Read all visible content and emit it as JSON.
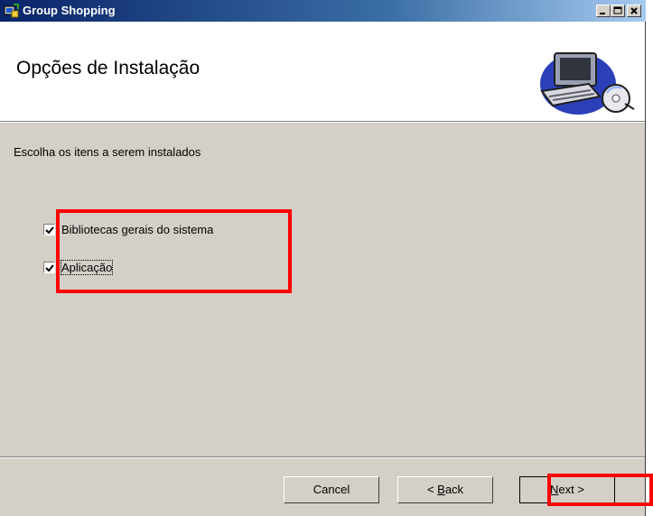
{
  "window": {
    "title": "Group Shopping"
  },
  "titlebar": {
    "minimize_icon": "minimize-icon",
    "maximize_icon": "maximize-icon",
    "close_icon": "close-icon"
  },
  "header": {
    "title": "Opções de Instalação",
    "art_icon": "computer-setup-icon"
  },
  "instructions": "Escolha os itens a serem instalados",
  "options": [
    {
      "label": "Bibliotecas gerais do sistema",
      "checked": true
    },
    {
      "label": "Aplicação",
      "checked": true
    }
  ],
  "buttons": {
    "cancel": "Cancel",
    "back_prefix": "< ",
    "back_mnemonic": "B",
    "back_rest": "ack",
    "next_mnemonic": "N",
    "next_rest": "ext >"
  },
  "colors": {
    "highlight": "#ff0000",
    "titlebar_start": "#0a246a",
    "face": "#d4d0c8"
  }
}
